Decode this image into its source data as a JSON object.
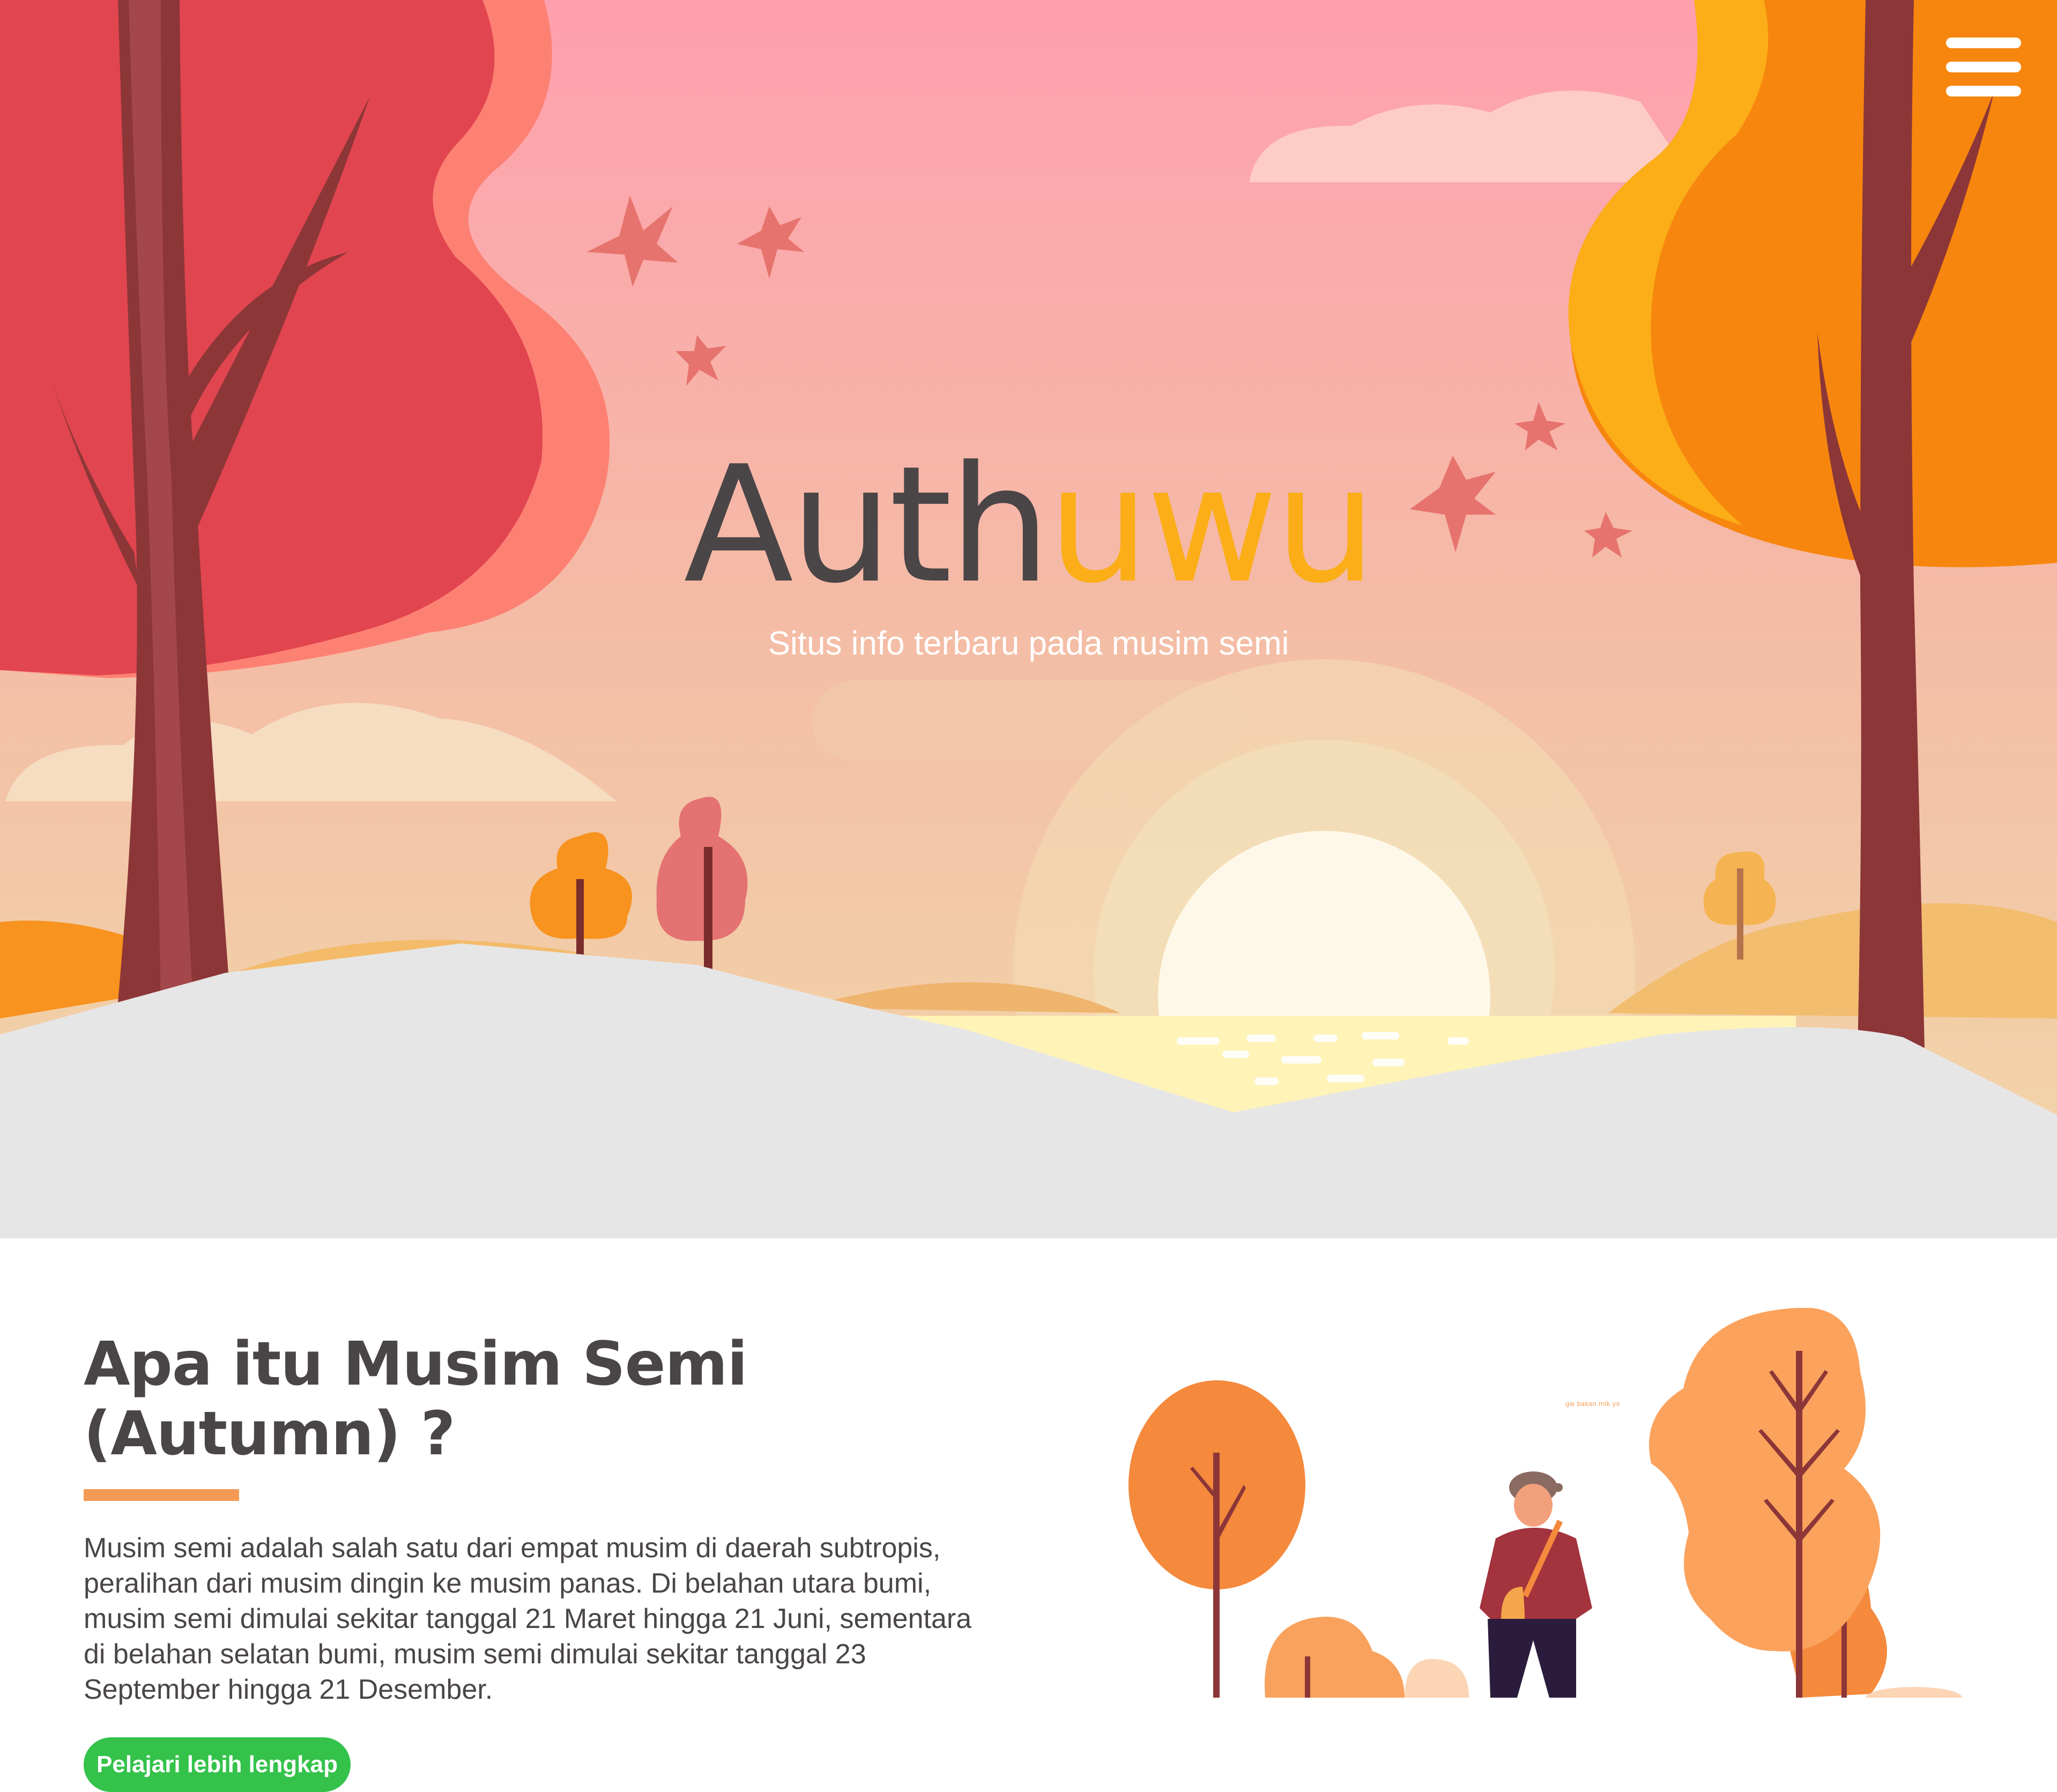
{
  "header": {
    "menu_icon": "hamburger-menu-icon"
  },
  "hero": {
    "logo_part1": "Auth",
    "logo_part2": "uwu",
    "tagline": "Situs info terbaru pada musim semi",
    "colors": {
      "logo_dark": "#4a4546",
      "logo_accent": "#fbae17",
      "sky_top": "#ff9fae",
      "sky_bottom": "#f1d8a8"
    }
  },
  "about": {
    "title": "Apa itu Musim Semi (Autumn) ?",
    "body": "Musim semi adalah salah satu dari empat musim di daerah subtropis, peralihan dari musim dingin ke musim panas. Di belahan utara bumi, musim semi dimulai sekitar tanggal 21 Maret hingga 21 Juni, sementara di belahan selatan bumi, musim semi dimulai sekitar tanggal 23 September hingga 21 Desember.",
    "cta_label": "Pelajari lebih lengkap",
    "illustration_caption": "gw bakan mik ye",
    "colors": {
      "underline": "#f49a55",
      "cta": "#34c24b"
    }
  }
}
